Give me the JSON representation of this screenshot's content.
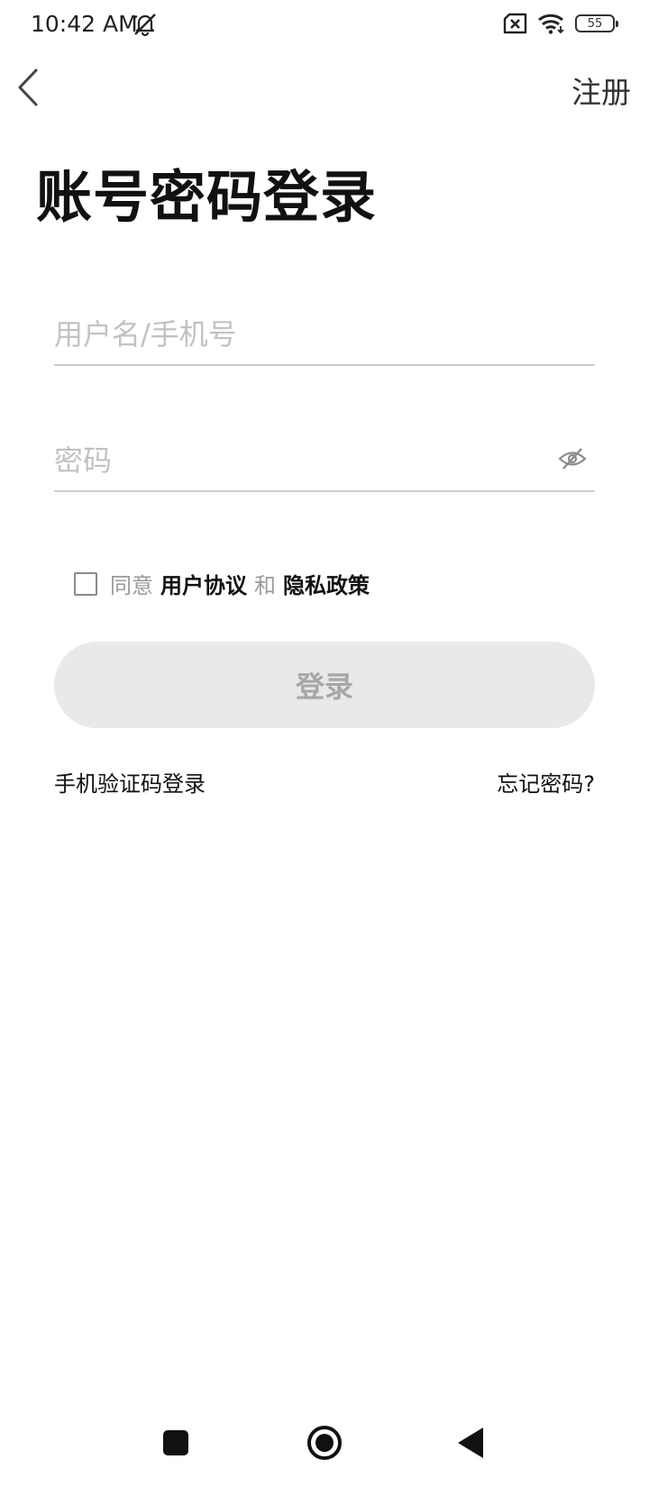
{
  "status_bar": {
    "time": "10:42 AM",
    "battery_level": "55",
    "icons": [
      "mute-icon",
      "sim-error-icon",
      "wifi-icon",
      "battery-icon"
    ]
  },
  "header": {
    "back_icon": "chevron-left-icon",
    "register_label": "注册"
  },
  "title": "账号密码登录",
  "form": {
    "username_placeholder": "用户名/手机号",
    "username_value": "",
    "password_placeholder": "密码",
    "password_value": "",
    "password_toggle_icon": "eye-off-icon"
  },
  "agreement": {
    "checked": false,
    "prefix": "同意",
    "user_agreement": "用户协议",
    "conjunction": "和",
    "privacy_policy": "隐私政策"
  },
  "login_button": {
    "label": "登录",
    "enabled": false
  },
  "links": {
    "sms_login": "手机验证码登录",
    "forgot_password": "忘记密码?"
  },
  "colors": {
    "text_primary": "#111111",
    "text_muted": "#9a9a9a",
    "placeholder": "#c2c2c2",
    "button_disabled_bg": "#e9e9e9",
    "button_disabled_text": "#a7a7a7",
    "divider": "#cfcfcf"
  },
  "nav_bar": {
    "icons": [
      "recent-apps-icon",
      "home-icon",
      "back-icon"
    ]
  }
}
